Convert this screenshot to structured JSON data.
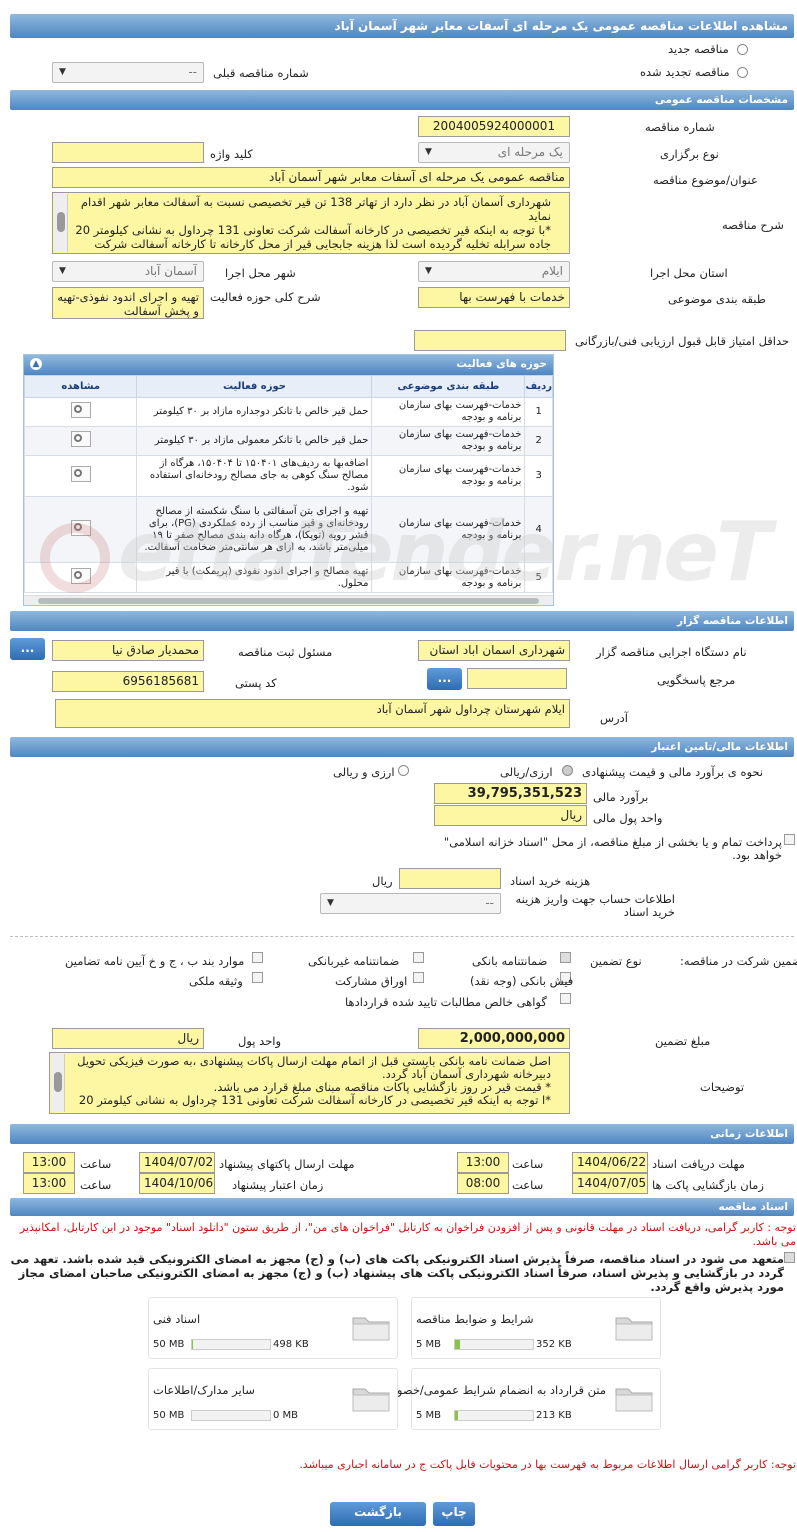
{
  "title": "مشاهده اطلاعات مناقصه عمومی یک مرحله ای آسفات معابر شهر آسمان آباد",
  "radios": {
    "new": "مناقصه جدید",
    "renew": "مناقصه تجدید شده",
    "prev_label": "شماره مناقصه قبلی",
    "prev_value": "--"
  },
  "general": {
    "header": "مشخصات مناقصه عمومی",
    "number_label": "شماره مناقصه",
    "number": "2004005924000001",
    "type_label": "نوع برگزاری",
    "type": "یک مرحله ای",
    "keyword_label": "کلید واژه",
    "subject_label": "عنوان/موضوع مناقصه",
    "subject": "مناقصه عمومی یک مرحله ای آسفات معابر شهر آسمان آباد",
    "desc_label": "شرح مناقصه",
    "desc": "شهرداری آسمان آباد در نظر دارد از تهاتر 138 تن قیر تخصیصی نسبت به آسفالت معابر شهر اقدام نماید\n*با توجه به اینکه قیر تخصیصی در کارخانه آسفالت شرکت تعاونی 131 چرداول به نشانی کیلومتر 20 جاده سرابله تخلیه گردیده است لذا هزینه جابجایی قیر از محل کارخانه تا کارخانه آسفالت شرکت",
    "province_label": "استان محل اجرا",
    "province": "ایلام",
    "city_label": "شهر محل اجرا",
    "city": "آسمان آباد",
    "category_label": "طبقه بندی موضوعی",
    "category": "خدمات با فهرست بها",
    "scope_label": "شرح کلی حوزه فعالیت",
    "scope": "تهیه و اجرای اندود نفوذی-تهیه و پخش آسفالت",
    "minscore_label": "حداقل امتیاز قابل قبول ارزیابی فنی/بازرگانی"
  },
  "activities": {
    "header": "حوزه های فعالیت",
    "columns": [
      "ردیف",
      "طبقه بندی موضوعی",
      "حوزه فعالیت",
      "مشاهده"
    ],
    "rows": [
      {
        "n": "1",
        "cat": "خدمات-فهرست بهای سازمان برنامه و بودجه",
        "act": "حمل قیر خالص با تانکر دوجداره مازاد بر ۳۰ کیلومتر"
      },
      {
        "n": "2",
        "cat": "خدمات-فهرست بهای سازمان برنامه و بودجه",
        "act": "حمل قیر خالص با تانکر معمولی مازاد بر ۳۰ کیلومتر"
      },
      {
        "n": "3",
        "cat": "خدمات-فهرست بهای سازمان برنامه و بودجه",
        "act": "اضافه‌بها به ردیف‌های ۱۵۰۴۰۱ تا ۱۵۰۴۰۴، هرگاه از مصالح سنگ کوهی به جای مصالح رودخانه‌ای استفاده شود."
      },
      {
        "n": "4",
        "cat": "خدمات-فهرست بهای سازمان برنامه و بودجه",
        "act": "تهیه و اجرای بتن آسفالتی با سنگ شکسته از مصالح رودخانه‌ای و قیر مناسب از رده عملکردی (PG)، برای قشر رویه (توپکا)، هرگاه دانه بندی مصالح صفر تا ۱۹ میلی‌متر باشد، به ازای هر سانتی‌متر ضخامت آسفالت."
      },
      {
        "n": "5",
        "cat": "خدمات-فهرست بهای سازمان برنامه و بودجه",
        "act": "تهیه مصالح و اجرای اندود نفوذی (پریمکت) با قیر محلول."
      }
    ]
  },
  "organizer": {
    "header": "اطلاعات مناقصه گزار",
    "org_label": "نام دستگاه اجرایی مناقصه گزار",
    "org": "شهرداری اسمان اباد استان",
    "resp_label": "مسئول ثبت مناقصه",
    "resp": "محمدیار صادق نیا",
    "ref_label": "مرجع پاسخگویی",
    "postal_label": "کد پستی",
    "postal": "6956185681",
    "addr_label": "آدرس",
    "addr": "ایلام شهرستان چرداول شهر آسمان آباد",
    "btn": "..."
  },
  "finance": {
    "header": "اطلاعات مالی/تامین اعتبار",
    "est_label": "نحوه ی برآورد مالی و قیمت پیشنهادی",
    "opt1": "ارزی/ریالی",
    "opt2": "ارزی و ریالی",
    "amount_label": "برآورد مالی",
    "amount": "39,795,351,523",
    "unit_label": "واحد پول مالی",
    "unit": "ریال",
    "treasury": "پرداخت تمام و یا بخشی از مبلغ مناقصه، از محل \"اسناد خزانه اسلامی\" خواهد بود.",
    "fee_label": "هزینه خرید اسناد",
    "fee_unit": "ریال",
    "acct_label": "اطلاعات حساب جهت واریز هزینه خرید اسناد",
    "acct": "--"
  },
  "guarantee": {
    "label": "تضمین شرکت در مناقصه:",
    "type_label": "نوع تضمین",
    "opts": [
      "ضمانتنامه بانکی",
      "ضمانتنامه غیربانکی",
      "موارد بند ب ، ج و خ آیین نامه تضامین",
      "فیش بانکی (وجه نقد)",
      "اوراق مشارکت",
      "وثیقه ملکی",
      "گواهی خالص مطالبات تایید شده قراردادها"
    ],
    "amount_label": "مبلغ تضمین",
    "amount": "2,000,000,000",
    "unit_label": "واحد پول",
    "unit": "ریال",
    "notes_label": "توضیحات",
    "notes": "اصل ضمانت نامه بانکی بایستی قبل از اتمام مهلت ارسال پاکات پیشنهادی ،به صورت فیزیکی تحویل دبیرخانه شهرداری آسمان آباد گردد.\n* قیمت قیر در روز بازگشایی پاکات مناقصه مبنای مبلغ قرارد می باشد.\n*ا توجه به اینکه قیر تخصیصی در کارخانه آسفالت شرکت تعاونی 131 چرداول به نشانی کیلومتر 20"
  },
  "timing": {
    "header": "اطلاعات زمانی",
    "recv_label": "مهلت دریافت اسناد",
    "recv_date": "1404/06/22",
    "recv_time": "13:00",
    "send_label": "مهلت ارسال پاکتهای پیشنهاد",
    "send_date": "1404/07/02",
    "send_time": "13:00",
    "open_label": "زمان بازگشایی پاکت ها",
    "open_date": "1404/07/05",
    "open_time": "08:00",
    "valid_label": "زمان اعتبار پیشنهاد",
    "valid_date": "1404/10/06",
    "valid_time": "13:00",
    "time_label": "ساعت"
  },
  "docs": {
    "header": "اسناد مناقصه",
    "note": "توجه : کاربر گرامی، دریافت اسناد در مهلت قانونی و پس از افزودن فراخوان به کارتابل \"فراخوان های من\"، از طریق ستون \"دانلود اسناد\" موجود در این کارتابل، امکانپذیر می باشد.",
    "commit": "متعهد می شود در اسناد مناقصه، صرفاً پذیرش اسناد الکترونیکی پاکت های (ب) و (ج) مجهز به امضای الکترونیکی قید شده باشد. تعهد می گردد در بازگشایی و پذیرش اسناد، صرفاً اسناد الکترونیکی پاکت های پیشنهاد (ب) و (ج) مجهز به امضای الکترونیکی صاحبان امضای مجاز مورد پذیرش واقع گردد.",
    "files": [
      {
        "name": "شرایط و ضوابط مناقصه",
        "size": "352 KB",
        "max": "5 MB",
        "fill": 0.07
      },
      {
        "name": "اسناد فنی",
        "size": "498 KB",
        "max": "50 MB",
        "fill": 0.01
      },
      {
        "name": "متن قرارداد به انضمام شرایط عمومی/خصوصی",
        "size": "213 KB",
        "max": "5 MB",
        "fill": 0.04
      },
      {
        "name": "سایر مدارک/اطلاعات",
        "size": "0 MB",
        "max": "50 MB",
        "fill": 0
      }
    ],
    "footer": "توجه: کاربر گرامی ارسال اطلاعات مربوط به فهرست بها در محتویات فایل پاکت ج در سامانه اجباری میباشد."
  },
  "buttons": {
    "print": "چاپ",
    "back": "بازگشت"
  },
  "watermark": "ettaTender.neT"
}
